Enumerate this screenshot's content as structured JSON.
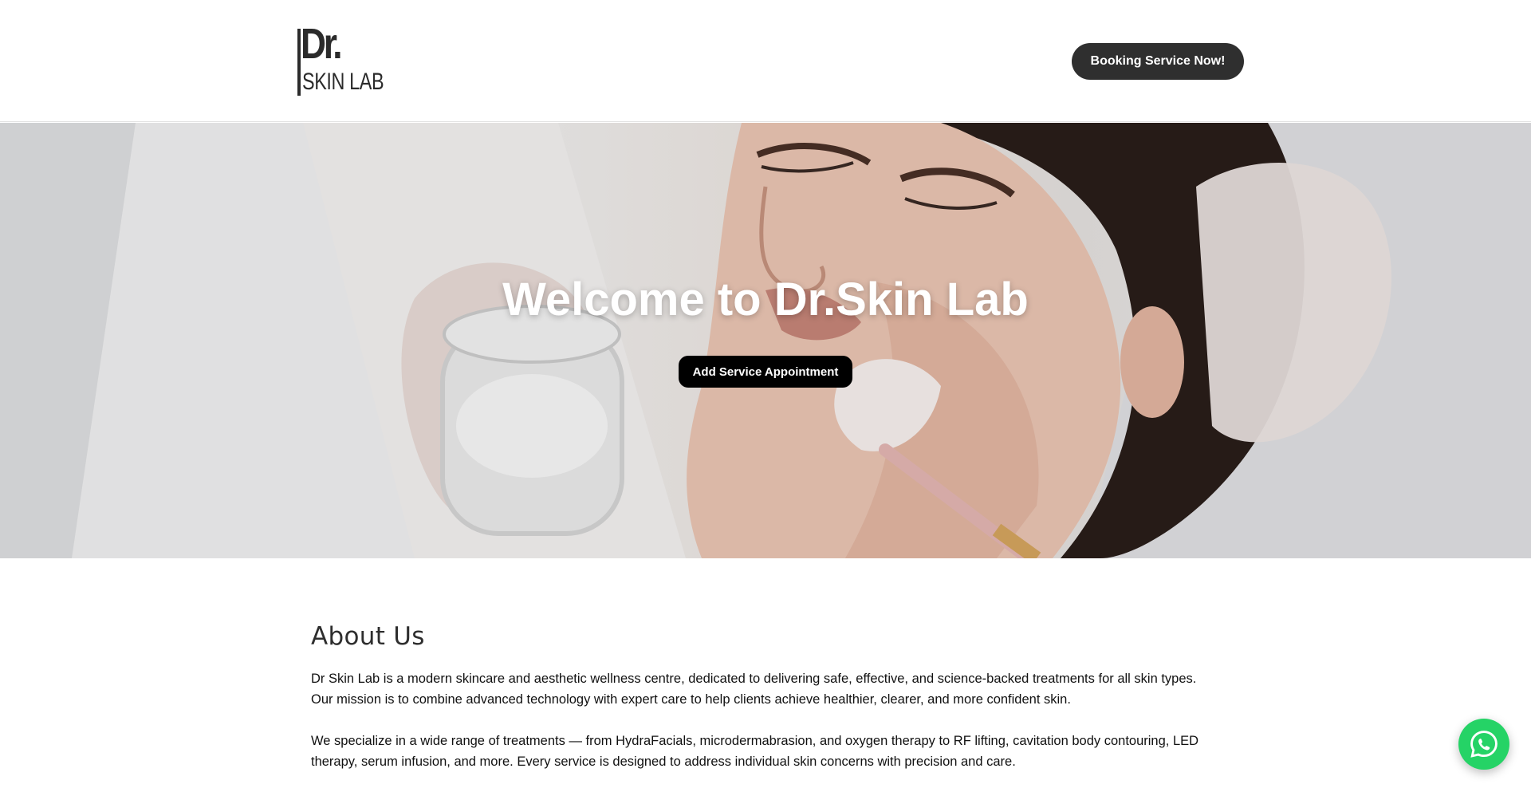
{
  "header": {
    "logo_line1": "Dr.",
    "logo_line2": "SKIN LAB",
    "booking_label": "Booking Service Now!"
  },
  "hero": {
    "title": "Welcome to Dr.Skin Lab",
    "appointment_label": "Add Service Appointment"
  },
  "about": {
    "title": "About Us",
    "paragraph1": "Dr Skin Lab is a modern skincare and aesthetic wellness centre, dedicated to delivering safe, effective, and science-backed treatments for all skin types. Our mission is to combine advanced technology with expert care to help clients achieve healthier, clearer, and more confident skin.",
    "paragraph2": "We specialize in a wide range of treatments — from HydraFacials, microdermabrasion, and oxygen therapy to RF lifting, cavitation body contouring, LED therapy, serum infusion, and more. Every service is designed to address individual skin concerns with precision and care."
  },
  "floating": {
    "whatsapp_icon": "whatsapp-icon"
  },
  "colors": {
    "booking_bg": "#2f2f2f",
    "appointment_bg": "#000000",
    "whatsapp": "#25d366"
  }
}
